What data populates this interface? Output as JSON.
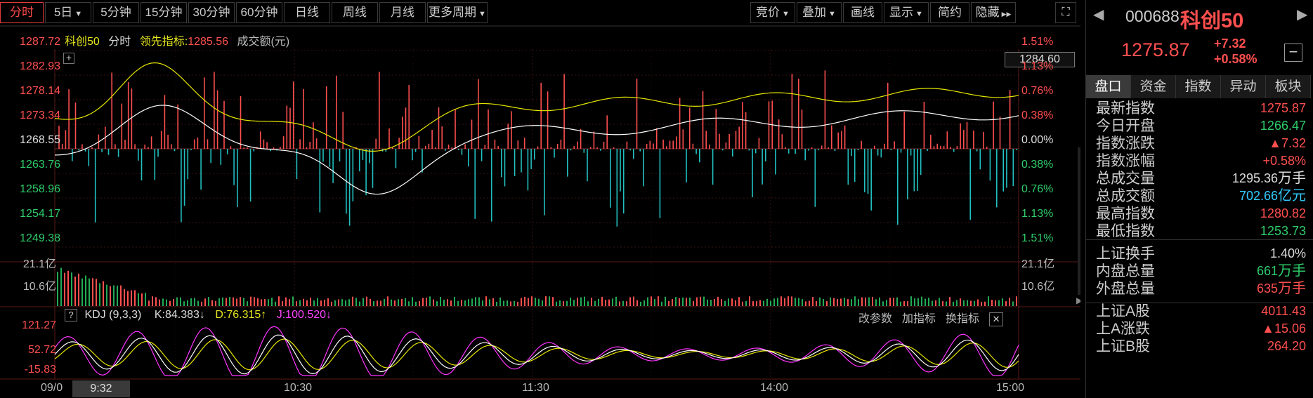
{
  "toolbar": {
    "left": [
      "分时",
      "5日",
      "5分钟",
      "15分钟",
      "30分钟",
      "60分钟",
      "日线",
      "周线",
      "月线",
      "更多周期"
    ],
    "right": [
      "竞价",
      "叠加",
      "画线",
      "显示",
      "简约",
      "隐藏"
    ],
    "expand_icon": "⛶"
  },
  "legend": {
    "name": "科创50",
    "mode": "分时",
    "lead_label": "领先指标:",
    "lead_value": "1285.56",
    "volume_label": "成交额(元)",
    "last_price": "1284.60"
  },
  "price_axis_left": [
    "1287.72",
    "1282.93",
    "1278.14",
    "1273.34",
    "1268.55",
    "1263.76",
    "1258.96",
    "1254.17",
    "1249.38"
  ],
  "price_axis_right": [
    "1.51%",
    "1.13%",
    "0.76%",
    "0.38%",
    "0.00%",
    "0.38%",
    "0.76%",
    "1.13%",
    "1.51%"
  ],
  "volume_axis": [
    "21.1亿",
    "10.6亿"
  ],
  "kdj": {
    "help": "?",
    "name": "KDJ (9,3,3)",
    "k": "K:84.383↓",
    "d": "D:76.315↑",
    "j": "J:100.520↓",
    "actions": [
      "改参数",
      "加指标",
      "换指标"
    ],
    "close": "✕",
    "axis": [
      "121.27",
      "52.72",
      "-15.83"
    ]
  },
  "time_axis": {
    "date": "09/0",
    "cursor": "9:32",
    "ticks": [
      "10:30",
      "11:30",
      "14:00",
      "15:00"
    ]
  },
  "side": {
    "code": "000688",
    "name": "科创50",
    "price": "1275.87",
    "change": "+7.32",
    "change_pct": "+0.58%",
    "minus_icon": "−",
    "tabs": [
      "盘口",
      "资金",
      "指数",
      "异动",
      "板块"
    ],
    "rows": [
      {
        "k": "最新指数",
        "v": "1275.87",
        "c": "red"
      },
      {
        "k": "今日开盘",
        "v": "1266.47",
        "c": "green"
      },
      {
        "k": "指数涨跌",
        "v": "▲7.32",
        "c": "red"
      },
      {
        "k": "指数涨幅",
        "v": "+0.58%",
        "c": "red"
      },
      {
        "k": "总成交量",
        "v": "1295.36",
        "u": "万手",
        "c": "white"
      },
      {
        "k": "总成交额",
        "v": "702.66",
        "u": "亿元",
        "c": "cyan"
      },
      {
        "k": "最高指数",
        "v": "1280.82",
        "c": "red"
      },
      {
        "k": "最低指数",
        "v": "1253.73",
        "c": "green"
      },
      {
        "k": "上证换手",
        "v": "1.40%",
        "c": "white"
      },
      {
        "k": "内盘总量",
        "v": "661",
        "u": "万手",
        "c": "green"
      },
      {
        "k": "外盘总量",
        "v": "635",
        "u": "万手",
        "c": "red"
      },
      {
        "k": "上证A股",
        "v": "4011.43",
        "c": "red"
      },
      {
        "k": "上A涨跌",
        "v": "▲15.06",
        "c": "red"
      },
      {
        "k": "上证B股",
        "v": "264.20",
        "c": "red"
      }
    ]
  },
  "colors": {
    "up": "#ff4f4f",
    "down": "#22c0c0",
    "price_line": "#e6e600",
    "avg_line": "#ffffff",
    "k_line": "#ffffff",
    "d_line": "#e6e600",
    "j_line": "#ff33ff"
  }
}
